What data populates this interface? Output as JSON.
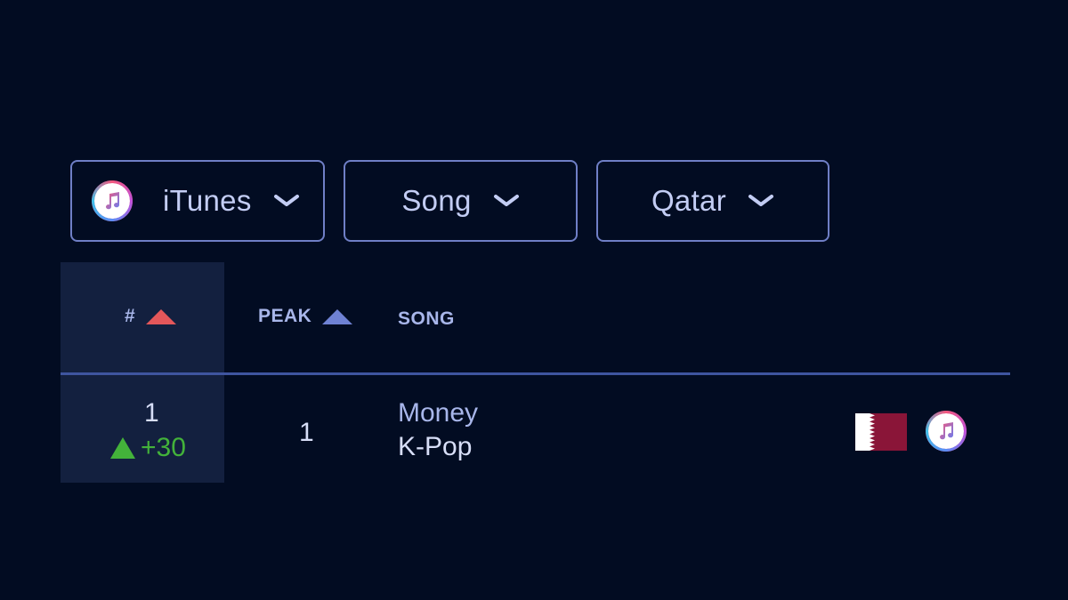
{
  "filters": {
    "platform": {
      "label": "iTunes",
      "icon": "itunes-icon"
    },
    "type": {
      "label": "Song"
    },
    "country": {
      "label": "Qatar"
    }
  },
  "table": {
    "headers": {
      "rank": "#",
      "peak": "PEAK",
      "song": "SONG"
    },
    "rows": [
      {
        "rank": "1",
        "change": "+30",
        "peak": "1",
        "title": "Money",
        "genre": "K-Pop",
        "flag": "qatar-flag-icon",
        "platform_icon": "itunes-icon"
      }
    ]
  },
  "colors": {
    "background": "#020c22",
    "border": "#6f7fc6",
    "rank_sort": "#e4575a",
    "peak_sort": "#6f82d4",
    "positive_change": "#43b23a",
    "qatar_maroon": "#8a1538"
  }
}
